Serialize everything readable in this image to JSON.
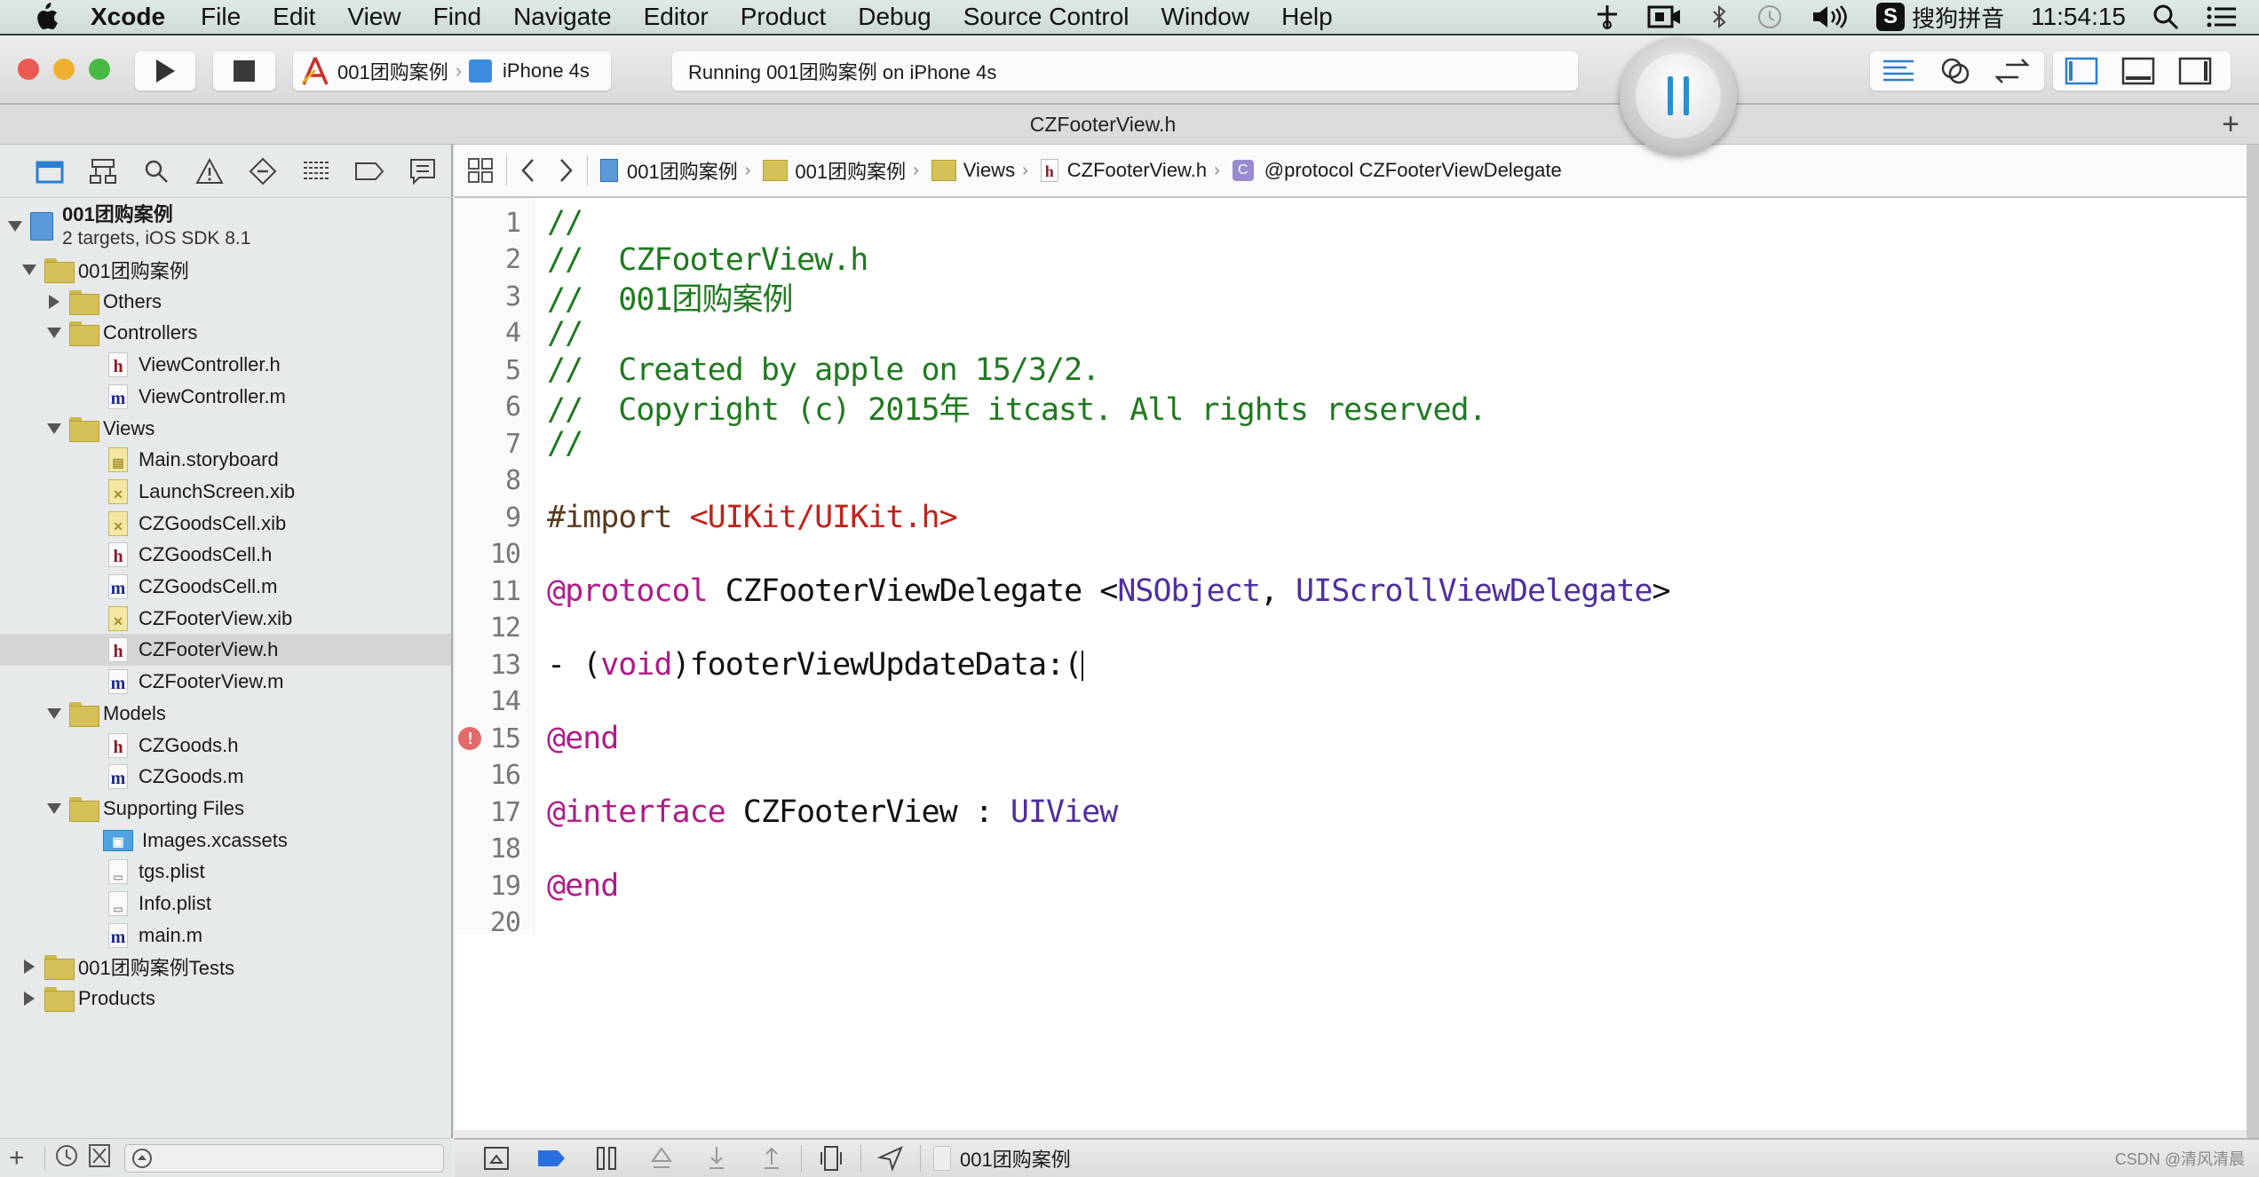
{
  "menubar": {
    "app_name": "Xcode",
    "items": [
      "File",
      "Edit",
      "View",
      "Find",
      "Navigate",
      "Editor",
      "Product",
      "Debug",
      "Source Control",
      "Window",
      "Help"
    ],
    "status": {
      "input_method": "搜狗拼音",
      "input_badge": "S",
      "clock": "11:54:15"
    }
  },
  "toolbar": {
    "scheme": "001团购案例",
    "destination": "iPhone 4s",
    "activity": "Running 001团购案例 on iPhone 4s"
  },
  "tabbar": {
    "title": "CZFooterView.h",
    "add_label": "+"
  },
  "jumpbar": {
    "crumbs": [
      "001团购案例",
      "001团购案例",
      "Views",
      "CZFooterView.h",
      "@protocol CZFooterViewDelegate"
    ]
  },
  "navigator": {
    "project": {
      "name": "001团购案例",
      "subtitle": "2 targets, iOS SDK 8.1"
    },
    "rows": [
      {
        "label": "001团购案例",
        "kind": "folder",
        "indent": 1,
        "disclosure": "open"
      },
      {
        "label": "Others",
        "kind": "folder",
        "indent": 2,
        "disclosure": "closed"
      },
      {
        "label": "Controllers",
        "kind": "folder",
        "indent": 2,
        "disclosure": "open"
      },
      {
        "label": "ViewController.h",
        "kind": "h",
        "indent": 3
      },
      {
        "label": "ViewController.m",
        "kind": "m",
        "indent": 3
      },
      {
        "label": "Views",
        "kind": "folder",
        "indent": 2,
        "disclosure": "open"
      },
      {
        "label": "Main.storyboard",
        "kind": "sb",
        "indent": 3
      },
      {
        "label": "LaunchScreen.xib",
        "kind": "xib",
        "indent": 3
      },
      {
        "label": "CZGoodsCell.xib",
        "kind": "xib",
        "indent": 3
      },
      {
        "label": "CZGoodsCell.h",
        "kind": "h",
        "indent": 3
      },
      {
        "label": "CZGoodsCell.m",
        "kind": "m",
        "indent": 3
      },
      {
        "label": "CZFooterView.xib",
        "kind": "xib",
        "indent": 3
      },
      {
        "label": "CZFooterView.h",
        "kind": "h",
        "indent": 3,
        "selected": true
      },
      {
        "label": "CZFooterView.m",
        "kind": "m",
        "indent": 3
      },
      {
        "label": "Models",
        "kind": "folder",
        "indent": 2,
        "disclosure": "open"
      },
      {
        "label": "CZGoods.h",
        "kind": "h",
        "indent": 3
      },
      {
        "label": "CZGoods.m",
        "kind": "m",
        "indent": 3
      },
      {
        "label": "Supporting Files",
        "kind": "folder",
        "indent": 2,
        "disclosure": "open"
      },
      {
        "label": "Images.xcassets",
        "kind": "assets",
        "indent": 3
      },
      {
        "label": "tgs.plist",
        "kind": "plist",
        "indent": 3
      },
      {
        "label": "Info.plist",
        "kind": "plist",
        "indent": 3
      },
      {
        "label": "main.m",
        "kind": "m",
        "indent": 3
      },
      {
        "label": "001团购案例Tests",
        "kind": "folder",
        "indent": 1,
        "disclosure": "closed"
      },
      {
        "label": "Products",
        "kind": "folder",
        "indent": 1,
        "disclosure": "closed"
      }
    ]
  },
  "editor": {
    "lines": [
      {
        "n": "1",
        "tokens": [
          [
            "c-comment",
            "//"
          ]
        ]
      },
      {
        "n": "2",
        "tokens": [
          [
            "c-comment",
            "//  CZFooterView.h"
          ]
        ]
      },
      {
        "n": "3",
        "tokens": [
          [
            "c-comment",
            "//  001团购案例"
          ]
        ]
      },
      {
        "n": "4",
        "tokens": [
          [
            "c-comment",
            "//"
          ]
        ]
      },
      {
        "n": "5",
        "tokens": [
          [
            "c-comment",
            "//  Created by apple on 15/3/2."
          ]
        ]
      },
      {
        "n": "6",
        "tokens": [
          [
            "c-comment",
            "//  Copyright (c) 2015年 itcast. All rights reserved."
          ]
        ]
      },
      {
        "n": "7",
        "tokens": [
          [
            "c-comment",
            "//"
          ]
        ]
      },
      {
        "n": "8",
        "tokens": []
      },
      {
        "n": "9",
        "tokens": [
          [
            "c-pre",
            "#import "
          ],
          [
            "c-str",
            "<UIKit/UIKit.h>"
          ]
        ]
      },
      {
        "n": "10",
        "tokens": []
      },
      {
        "n": "11",
        "tokens": [
          [
            "c-kw",
            "@protocol"
          ],
          [
            "c-plain",
            " CZFooterViewDelegate <"
          ],
          [
            "c-type",
            "NSObject"
          ],
          [
            "c-plain",
            ", "
          ],
          [
            "c-type",
            "UIScrollViewDelegate"
          ],
          [
            "c-plain",
            ">"
          ]
        ]
      },
      {
        "n": "12",
        "tokens": []
      },
      {
        "n": "13",
        "tokens": [
          [
            "c-plain",
            "- ("
          ],
          [
            "c-kw",
            "void"
          ],
          [
            "c-plain",
            ")footerViewUpdateData:("
          ]
        ],
        "caret": true
      },
      {
        "n": "14",
        "tokens": []
      },
      {
        "n": "15",
        "tokens": [
          [
            "c-kw",
            "@end"
          ]
        ],
        "error": true
      },
      {
        "n": "16",
        "tokens": []
      },
      {
        "n": "17",
        "tokens": [
          [
            "c-kw",
            "@interface"
          ],
          [
            "c-plain",
            " CZFooterView : "
          ],
          [
            "c-type",
            "UIView"
          ]
        ]
      },
      {
        "n": "18",
        "tokens": []
      },
      {
        "n": "19",
        "tokens": [
          [
            "c-kw",
            "@end"
          ]
        ]
      },
      {
        "n": "20",
        "tokens": []
      }
    ],
    "error_badge": "!"
  },
  "debugbar": {
    "target": "001团购案例"
  },
  "watermark": "CSDN @清风清晨",
  "colors": {
    "comment": "#1f7a1f",
    "keyword": "#ad1b8a",
    "string": "#c0231b",
    "type": "#4d2fa0",
    "accent": "#2a8fd0"
  }
}
